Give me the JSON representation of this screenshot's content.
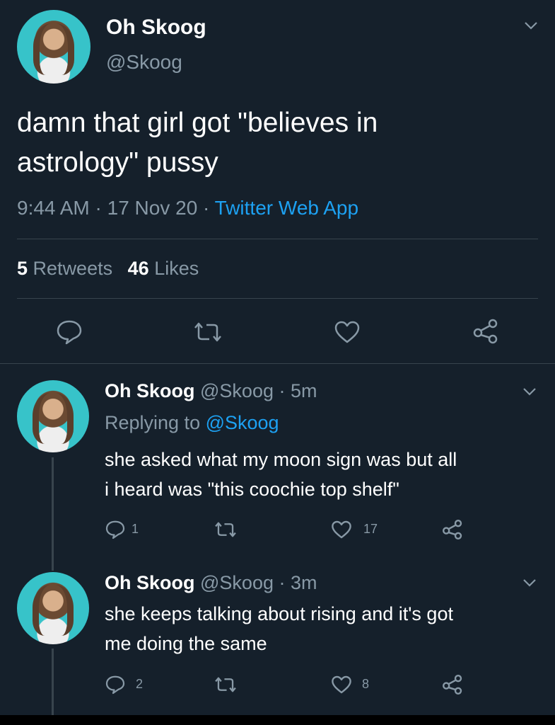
{
  "main_tweet": {
    "display_name": "Oh Skoog",
    "handle": "@Skoog",
    "text_line1": "damn that girl got \"believes in",
    "text_line2": "astrology\" pussy",
    "time": "9:44 AM",
    "date": "17 Nov 20",
    "sep": "·",
    "source": "Twitter Web App",
    "retweets_count": "5",
    "retweets_label": "Retweets",
    "likes_count": "46",
    "likes_label": "Likes"
  },
  "replies": [
    {
      "display_name": "Oh Skoog",
      "handle_time": "@Skoog · 5m",
      "replying_prefix": "Replying to",
      "replying_handle": "@Skoog",
      "text_line1": "she asked what my moon sign was but all",
      "text_line2": "i heard was \"this coochie top shelf\"",
      "reply_count": "1",
      "like_count": "17"
    },
    {
      "display_name": "Oh Skoog",
      "handle_time": "@Skoog · 3m",
      "text_line1": "she keeps talking about rising and it's got",
      "text_line2": "me doing the same",
      "reply_count": "2",
      "like_count": "8"
    }
  ],
  "icons": [
    "chevron-down-icon",
    "reply-icon",
    "retweet-icon",
    "like-icon",
    "share-icon"
  ],
  "colors": {
    "background": "#15202b",
    "link": "#1da1f2",
    "muted": "#8899a6",
    "avatar_bg": "#37c3c9"
  }
}
